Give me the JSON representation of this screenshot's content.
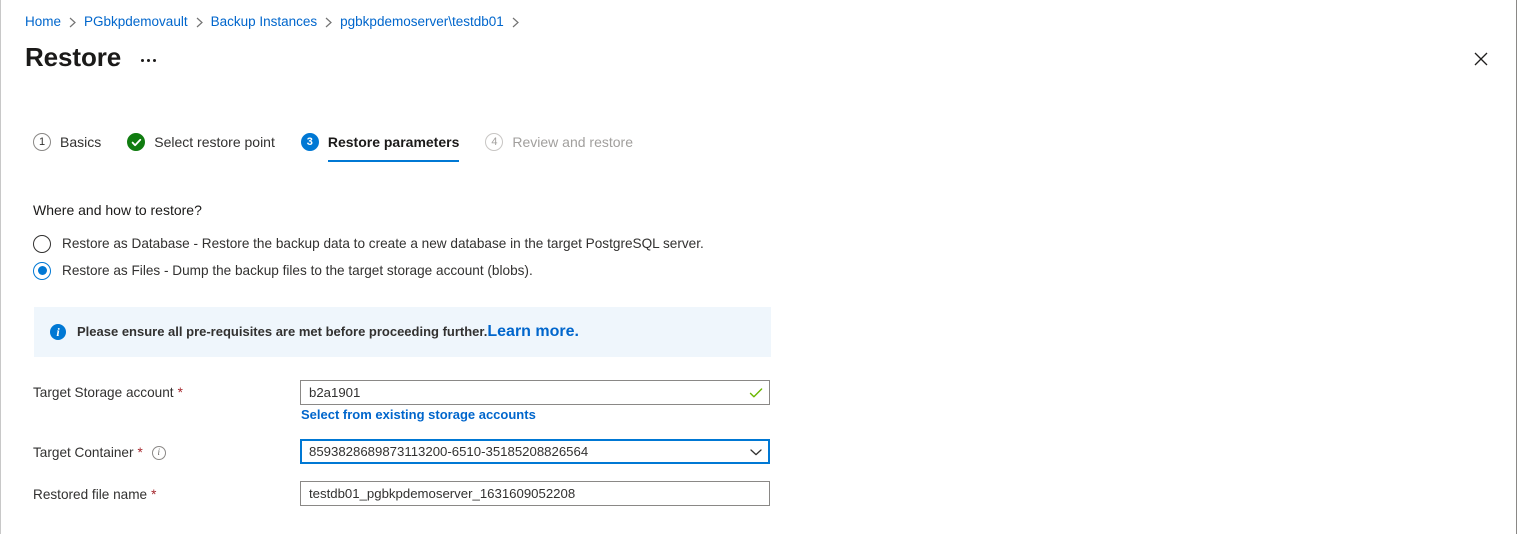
{
  "breadcrumb": {
    "items": [
      {
        "label": "Home"
      },
      {
        "label": "PGbkpdemovault"
      },
      {
        "label": "Backup Instances"
      },
      {
        "label": "pgbkpdemoserver\\testdb01"
      }
    ]
  },
  "header": {
    "title": "Restore",
    "more_menu": "more-commands",
    "close": "close"
  },
  "wizard": {
    "steps": [
      {
        "badge": "1",
        "label": "Basics",
        "state": "pending"
      },
      {
        "badge": "✓",
        "label": "Select restore point",
        "state": "completed"
      },
      {
        "badge": "3",
        "label": "Restore parameters",
        "state": "active"
      },
      {
        "badge": "4",
        "label": "Review and restore",
        "state": "disabled"
      }
    ]
  },
  "main": {
    "section_heading": "Where and how to restore?",
    "restore_options": [
      {
        "label": "Restore as Database - Restore the backup data to create a new database in the target PostgreSQL server.",
        "selected": false
      },
      {
        "label": "Restore as Files - Dump the backup files to the target storage account (blobs).",
        "selected": true
      }
    ],
    "info_banner": {
      "text": "Please ensure all pre-requisites are met before proceeding further.",
      "link_text": "Learn more.",
      "background": "#eff6fc",
      "icon_color": "#0078d4"
    },
    "fields": {
      "storage_account": {
        "label": "Target Storage account",
        "required": true,
        "value": "b2a1901",
        "validated": true,
        "validation_color": "#6bb700",
        "sublink": "Select from existing storage accounts"
      },
      "container": {
        "label": "Target Container",
        "required": true,
        "has_info": true,
        "value": "8593828689873113200-6510-35185208826564",
        "focused": true,
        "focus_color": "#0078d4"
      },
      "restored_file_name": {
        "label": "Restored file name",
        "required": true,
        "value": "testdb01_pgbkpdemoserver_1631609052208"
      }
    }
  },
  "theme": {
    "link": "#0066cc",
    "accent": "#0078d4",
    "required": "#a4262c",
    "success": "#107c10"
  }
}
